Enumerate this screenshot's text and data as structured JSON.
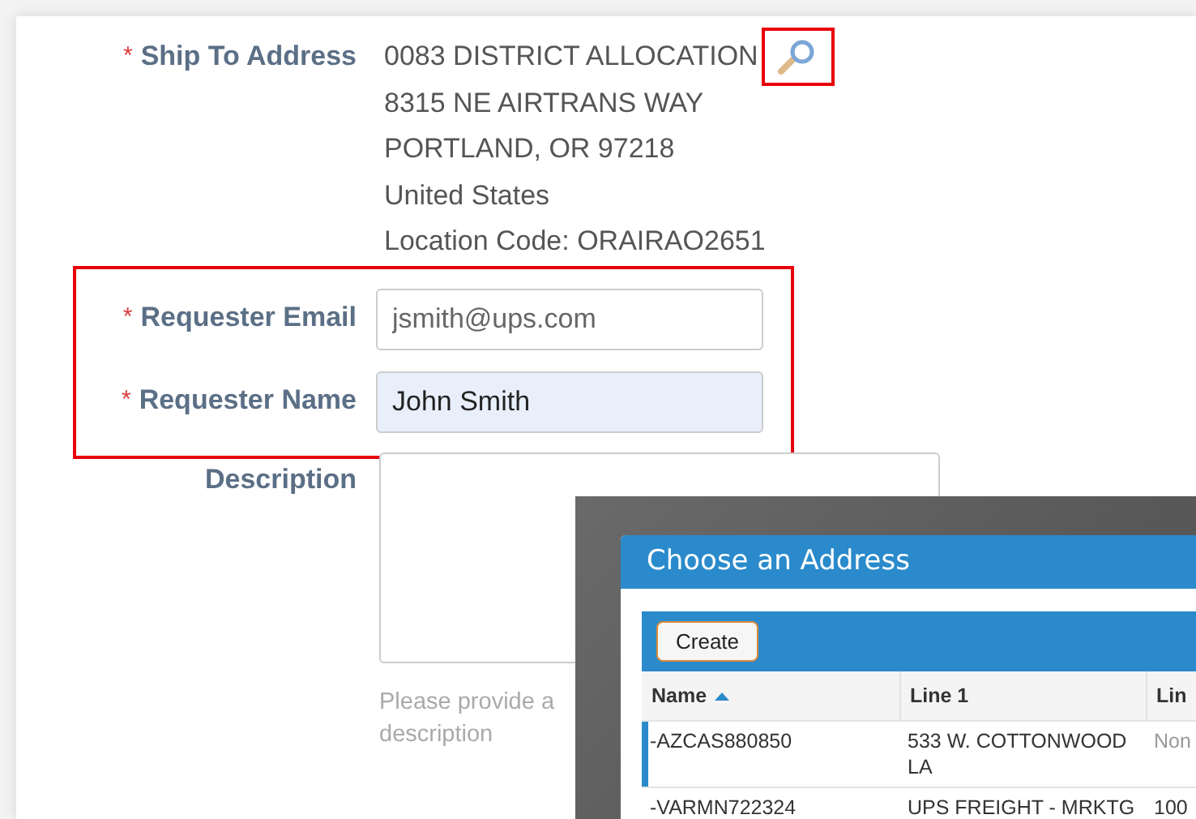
{
  "ship_to": {
    "marker": "*",
    "label": "Ship To Address",
    "lines": [
      "0083 DISTRICT ALLOCATION",
      "8315 NE AIRTRANS WAY",
      "PORTLAND, OR 97218",
      "United States",
      "Location Code: ORAIRAO2651"
    ],
    "lookup_highlighted": true
  },
  "requester_group": {
    "highlighted": true,
    "fields": [
      {
        "marker": "*",
        "label": "Requester Email",
        "placeholder": "jsmith@ups.com",
        "autofilled": false
      },
      {
        "marker": "*",
        "label": "Requester Name",
        "value": "John Smith",
        "autofilled": true
      }
    ]
  },
  "description": {
    "label": "Description",
    "hint_lines": [
      "Please provide a",
      "description"
    ]
  },
  "dialog": {
    "title": "Choose an Address",
    "toolbar": {
      "button": "Create"
    },
    "columns": [
      {
        "label": "Name",
        "sorted": true
      },
      {
        "label": "Line 1",
        "sorted": false
      },
      {
        "label": "Lin",
        "sorted": false
      }
    ],
    "rows": [
      {
        "selected": true,
        "cells": [
          {
            "text": "-AZCAS880850",
            "muted": false
          },
          {
            "text": "533 W. COTTONWOOD LA",
            "muted": false
          },
          {
            "text": "Non",
            "muted": true
          }
        ]
      },
      {
        "selected": false,
        "cells": [
          {
            "text": "-VARMN722324",
            "muted": false
          },
          {
            "text": "UPS FREIGHT - MRKTG",
            "muted": false
          },
          {
            "text": "100",
            "muted": false
          }
        ]
      }
    ]
  }
}
